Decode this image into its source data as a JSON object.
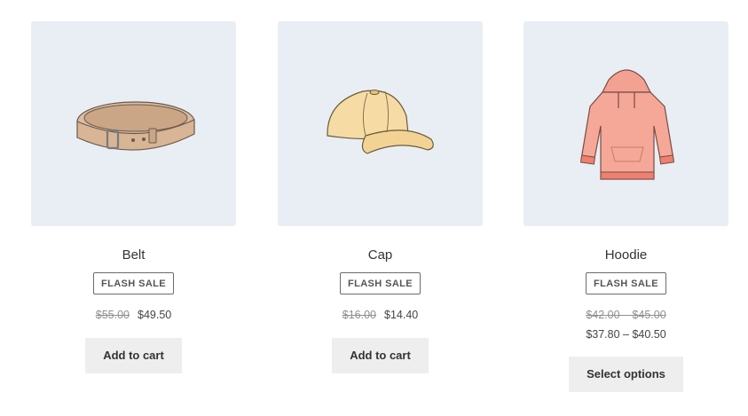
{
  "products": [
    {
      "title": "Belt",
      "badge": "FLASH SALE",
      "price_old": "$55.00",
      "price_new": "$49.50",
      "button": "Add to cart",
      "image_icon": "belt-icon"
    },
    {
      "title": "Cap",
      "badge": "FLASH SALE",
      "price_old": "$16.00",
      "price_new": "$14.40",
      "button": "Add to cart",
      "image_icon": "cap-icon"
    },
    {
      "title": "Hoodie",
      "badge": "FLASH SALE",
      "price_old_range": "$42.00 – $45.00",
      "price_new_range": "$37.80 – $40.50",
      "button": "Select options",
      "image_icon": "hoodie-icon"
    }
  ],
  "colors": {
    "image_bg": "#e8eef3",
    "button_bg": "#eeeeee",
    "belt": "#d8b99c",
    "cap": "#f5d9a0",
    "hoodie": "#f29a8e"
  }
}
